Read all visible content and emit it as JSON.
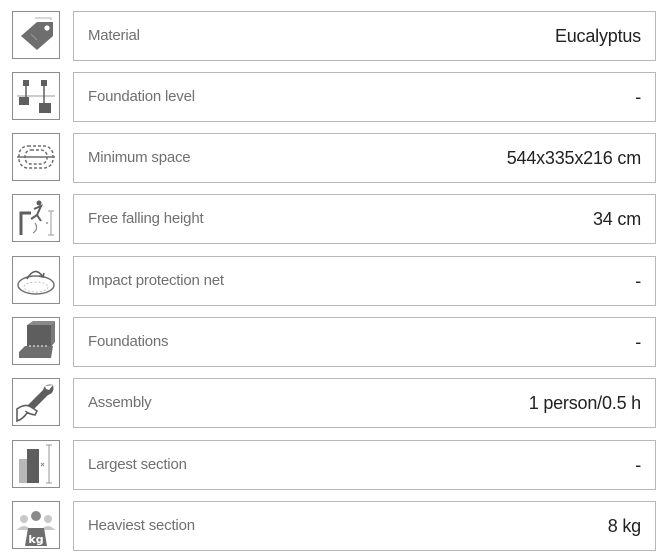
{
  "specs": [
    {
      "icon": "tag-icon",
      "label": "Material",
      "value": "Eucalyptus"
    },
    {
      "icon": "foundation-level-icon",
      "label": "Foundation level",
      "value": "-"
    },
    {
      "icon": "minimum-space-icon",
      "label": "Minimum space",
      "value": "544x335x216 cm"
    },
    {
      "icon": "free-falling-height-icon",
      "label": "Free falling height",
      "value": "34 cm"
    },
    {
      "icon": "impact-protection-net-icon",
      "label": "Impact protection net",
      "value": "-"
    },
    {
      "icon": "foundations-icon",
      "label": "Foundations",
      "value": "-"
    },
    {
      "icon": "assembly-wrench-icon",
      "label": "Assembly",
      "value": "1 person/0.5 h"
    },
    {
      "icon": "largest-section-icon",
      "label": "Largest section",
      "value": "-"
    },
    {
      "icon": "weight-kg-icon",
      "label": "Heaviest section",
      "value": "8 kg"
    }
  ],
  "weight_icon_text": "kg"
}
